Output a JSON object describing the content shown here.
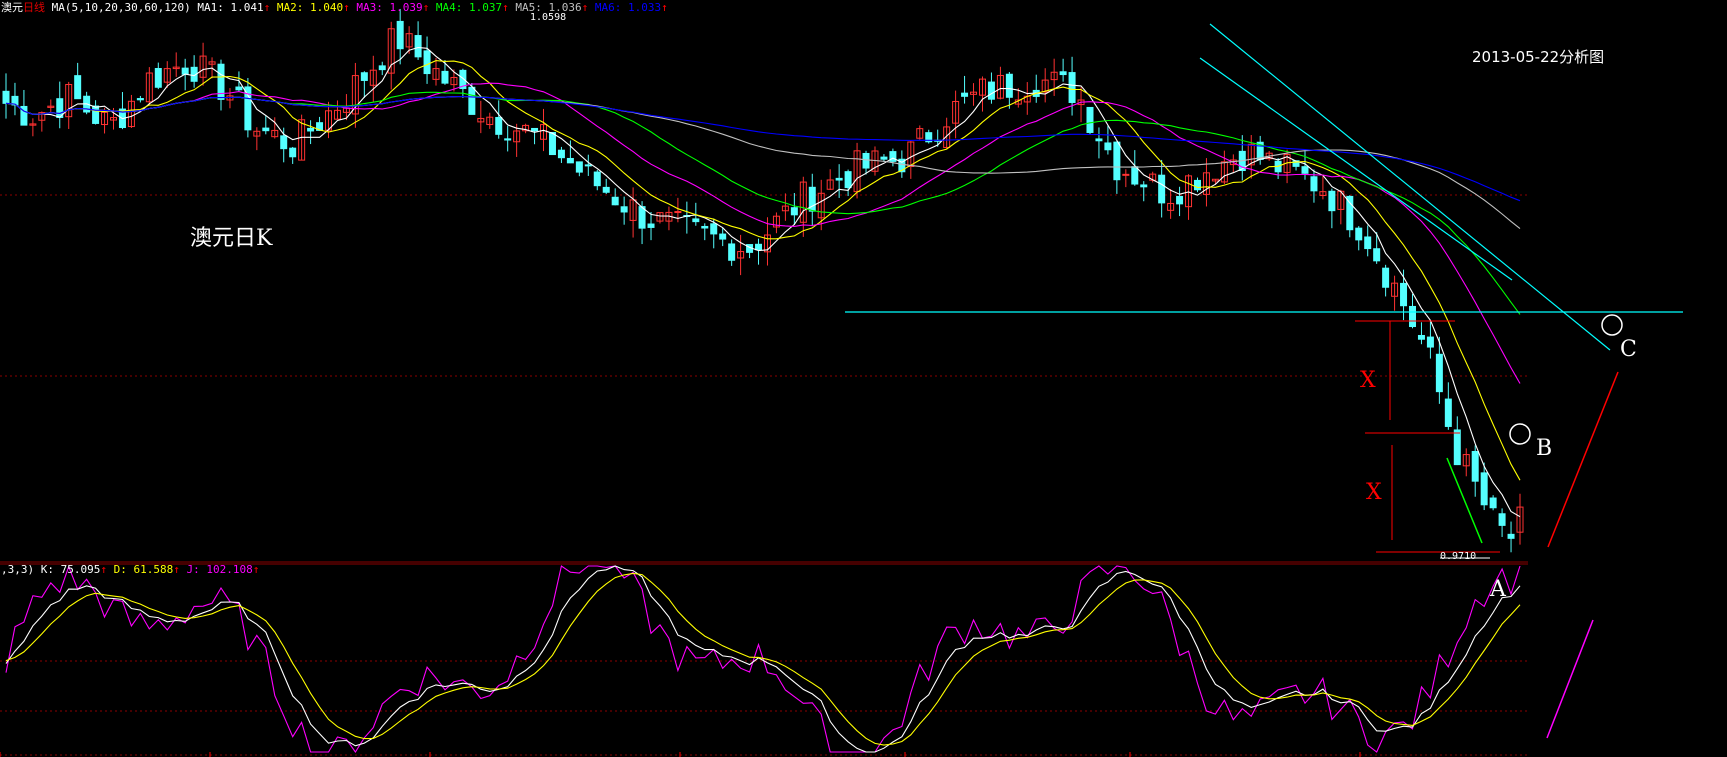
{
  "header": {
    "symbol": "澳元",
    "period": "日线",
    "ma_params": "MA(5,10,20,30,60,120)",
    "ma": [
      {
        "name": "MA1:",
        "value": "1.041",
        "arrow": "↑",
        "color": "#ffffff"
      },
      {
        "name": "MA2:",
        "value": "1.040",
        "arrow": "↑",
        "color": "#ffff00"
      },
      {
        "name": "MA3:",
        "value": "1.039",
        "arrow": "↑",
        "color": "#ff00ff"
      },
      {
        "name": "MA4:",
        "value": "1.037",
        "arrow": "↑",
        "color": "#00ff00"
      },
      {
        "name": "MA5:",
        "value": "1.036",
        "arrow": "↑",
        "color": "#c0c0c0"
      },
      {
        "name": "MA6:",
        "value": "1.033",
        "arrow": "↑",
        "color": "#0000ff"
      }
    ]
  },
  "kdj_header": {
    "params": ",3,3)",
    "items": [
      {
        "name": "K:",
        "value": "75.095",
        "arrow": "↑",
        "color": "#ffffff"
      },
      {
        "name": "D:",
        "value": "61.588",
        "arrow": "↑",
        "color": "#ffff00"
      },
      {
        "name": "J:",
        "value": "102.108",
        "arrow": "↑",
        "color": "#ff00ff"
      }
    ]
  },
  "annotations": {
    "date_label": "2013-05-22分析图",
    "title_label": "澳元日K",
    "high_label": "1.0598",
    "low_label": "0.9710",
    "point_a": "A",
    "point_b": "B",
    "point_c": "C",
    "x_top": "X",
    "x_bottom": "X"
  },
  "colors": {
    "up": "#ff3232",
    "down": "#54ffff",
    "ma1": "#ffffff",
    "ma2": "#ffff00",
    "ma3": "#ff00ff",
    "ma4": "#00ff00",
    "ma5": "#c0c0c0",
    "ma6": "#0000ff",
    "trendline": "#00ffff",
    "grid": "#8b0000"
  },
  "chart_data": {
    "type": "candlestick",
    "price_range": [
      0.971,
      1.0598
    ],
    "high": 1.0598,
    "low": 0.971,
    "indicators": [
      "MA(5,10,20,30,60,120)",
      "KDJ"
    ],
    "kdj_latest": {
      "K": 75.095,
      "D": 61.588,
      "J": 102.108
    },
    "ma_latest": {
      "MA1": 1.041,
      "MA2": 1.04,
      "MA3": 1.039,
      "MA4": 1.037,
      "MA5": 1.036,
      "MA6": 1.033
    }
  }
}
